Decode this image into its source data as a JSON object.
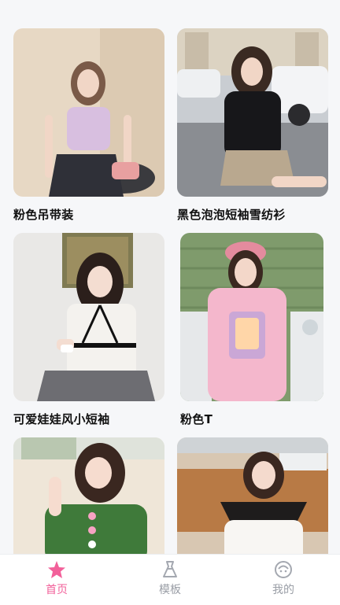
{
  "products": [
    {
      "title": "粉色吊带装"
    },
    {
      "title": "黑色泡泡短袖雪纺衫"
    },
    {
      "title": "可爱娃娃风小短袖"
    },
    {
      "title": "粉色T"
    },
    {
      "title": ""
    },
    {
      "title": ""
    }
  ],
  "tabbar": {
    "items": [
      {
        "label": "首页",
        "icon": "star-icon",
        "active": true
      },
      {
        "label": "模板",
        "icon": "dress-icon",
        "active": false
      },
      {
        "label": "我的",
        "icon": "profile-icon",
        "active": false
      }
    ]
  },
  "colors": {
    "accent": "#f2609a",
    "inactive": "#9a9ea6"
  }
}
